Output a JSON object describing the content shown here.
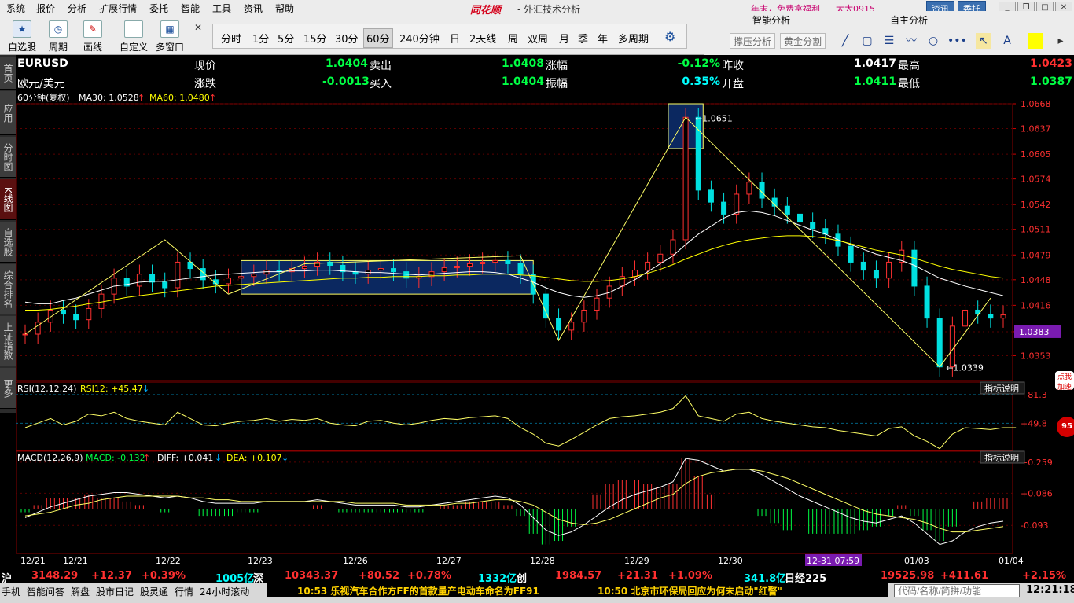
{
  "menubar": {
    "items": [
      "系统",
      "报价",
      "分析",
      "扩展行情",
      "委托",
      "智能",
      "工具",
      "资讯",
      "帮助"
    ],
    "title": "同花顺",
    "subtitle": "- 外汇技术分析",
    "promo": "年末，免费拿福利",
    "user": "太太0915",
    "btn_news": "资讯",
    "btn_trade": "委托"
  },
  "toolbar": {
    "buttons": [
      "自选股",
      "周期",
      "画线",
      "自定义",
      "多窗口"
    ],
    "periods": [
      "分时",
      "1分",
      "5分",
      "15分",
      "30分",
      "60分",
      "240分钟",
      "日",
      "2天线",
      "周",
      "双周",
      "月",
      "季",
      "年",
      "多周期"
    ],
    "active_period": "60分"
  },
  "side_panel": {
    "tab_smart": "智能分析",
    "tab_self": "自主分析",
    "btn_pressure": "撑压分析",
    "btn_gold": "黄金分割"
  },
  "leftnav": [
    "首页",
    "应用",
    "分时图",
    "K线图",
    "自选股",
    "综合排名",
    "上证指数",
    "更多"
  ],
  "quote": {
    "symbol": "EURUSD",
    "name": "欧元/美元",
    "l_price": "现价",
    "price": "1.0404",
    "l_change": "涨跌",
    "change": "-0.0013",
    "l_sell": "卖出",
    "sell": "1.0408",
    "l_buy": "买入",
    "buy": "1.0404",
    "l_pct": "涨幅",
    "pct": "-0.12%",
    "l_amp": "振幅",
    "amp": "0.35%",
    "l_prev": "昨收",
    "prev": "1.0417",
    "l_open": "开盘",
    "open": "1.0411",
    "l_high": "最高",
    "high": "1.0423",
    "l_low": "最低",
    "low": "1.0387"
  },
  "chart_data": {
    "type": "line",
    "title": "60分钟(复权)",
    "ma_legend": [
      "MA30: 1.0528",
      "MA60: 1.0480"
    ],
    "ylim": [
      1.0322,
      1.0668
    ],
    "y_ticks": [
      "1.0668",
      "1.0637",
      "1.0605",
      "1.0574",
      "1.0542",
      "1.0511",
      "1.0479",
      "1.0448",
      "1.0416",
      "1.0383",
      "1.0353"
    ],
    "current_tag": "1.0383",
    "annot_high": "1.0651",
    "annot_low": "1.0339",
    "x_labels": [
      "12/21",
      "12/21",
      "12/22",
      "12/23",
      "12/26",
      "12/27",
      "12/28",
      "12/29",
      "12/30",
      "12-31 07:59",
      "01/03",
      "01/04"
    ],
    "close_series": [
      1.038,
      1.0395,
      1.041,
      1.0405,
      1.0398,
      1.0412,
      1.043,
      1.045,
      1.044,
      1.0455,
      1.0445,
      1.0438,
      1.047,
      1.0462,
      1.0448,
      1.0443,
      1.045,
      1.0452,
      1.0455,
      1.046,
      1.0458,
      1.0462,
      1.0465,
      1.047,
      1.0466,
      1.0458,
      1.0455,
      1.046,
      1.0462,
      1.0458,
      1.045,
      1.0452,
      1.0458,
      1.0463,
      1.0465,
      1.0468,
      1.047,
      1.0472,
      1.0468,
      1.0455,
      1.043,
      1.04,
      1.0385,
      1.0395,
      1.041,
      1.0425,
      1.044,
      1.0452,
      1.046,
      1.047,
      1.048,
      1.0498,
      1.0651,
      1.056,
      1.0545,
      1.053,
      1.0555,
      1.057,
      1.055,
      1.054,
      1.053,
      1.052,
      1.0512,
      1.0505,
      1.049,
      1.047,
      1.046,
      1.045,
      1.047,
      1.0485,
      1.044,
      1.04,
      1.0339,
      1.039,
      1.041,
      1.0405,
      1.04,
      1.0404
    ],
    "ma30_series": [
      1.042,
      1.0418,
      1.0418,
      1.0422,
      1.0425,
      1.043,
      1.0435,
      1.044,
      1.0442,
      1.0445,
      1.0446,
      1.0446,
      1.0448,
      1.045,
      1.0452,
      1.0454,
      1.0455,
      1.0456,
      1.0457,
      1.0458,
      1.0458,
      1.0459,
      1.0459,
      1.046,
      1.046,
      1.0459,
      1.0458,
      1.0457,
      1.0457,
      1.0456,
      1.0455,
      1.0454,
      1.0455,
      1.0456,
      1.0457,
      1.0458,
      1.0458,
      1.0457,
      1.0455,
      1.045,
      1.0445,
      1.0438,
      1.0432,
      1.0428,
      1.0426,
      1.0428,
      1.0432,
      1.044,
      1.0448,
      1.0458,
      1.0468,
      1.0478,
      1.0492,
      1.0505,
      1.0515,
      1.0525,
      1.0532,
      1.0534,
      1.0532,
      1.0528,
      1.0522,
      1.0516,
      1.051,
      1.0505,
      1.0498,
      1.0492,
      1.0486,
      1.048,
      1.0476,
      1.0472,
      1.0466,
      1.0458,
      1.045,
      1.0445,
      1.044,
      1.0436,
      1.0432,
      1.0428
    ],
    "ma60_series": [
      1.041,
      1.041,
      1.0411,
      1.0413,
      1.0415,
      1.0418,
      1.042,
      1.0423,
      1.0426,
      1.0428,
      1.043,
      1.0432,
      1.0434,
      1.0436,
      1.0438,
      1.044,
      1.0441,
      1.0442,
      1.0443,
      1.0444,
      1.0445,
      1.0446,
      1.0447,
      1.0448,
      1.0449,
      1.045,
      1.045,
      1.0451,
      1.0451,
      1.0452,
      1.0452,
      1.0452,
      1.0453,
      1.0453,
      1.0454,
      1.0454,
      1.0455,
      1.0455,
      1.0455,
      1.0454,
      1.0453,
      1.0451,
      1.0449,
      1.0447,
      1.0446,
      1.0446,
      1.0447,
      1.0449,
      1.0452,
      1.0456,
      1.0461,
      1.0467,
      1.0474,
      1.048,
      1.0486,
      1.0491,
      1.0495,
      1.0498,
      1.05,
      1.0502,
      1.0503,
      1.0503,
      1.0502,
      1.05,
      1.0497,
      1.0493,
      1.0489,
      1.0485,
      1.0482,
      1.0479,
      1.0475,
      1.047,
      1.0465,
      1.0461,
      1.0458,
      1.0455,
      1.0452,
      1.045
    ],
    "rsi": {
      "legend": "RSI(12,12,24)",
      "value_label": "RSI12: +45.47",
      "ylim": [
        20,
        95
      ],
      "ticks": [
        "81.3",
        "49.8"
      ],
      "values": [
        45,
        50,
        55,
        48,
        52,
        60,
        58,
        62,
        55,
        52,
        50,
        48,
        62,
        55,
        48,
        47,
        50,
        52,
        53,
        55,
        52,
        54,
        53,
        55,
        50,
        48,
        47,
        52,
        53,
        50,
        48,
        50,
        53,
        55,
        54,
        56,
        57,
        58,
        55,
        45,
        38,
        28,
        25,
        32,
        40,
        48,
        55,
        57,
        58,
        60,
        62,
        66,
        80,
        58,
        55,
        52,
        60,
        62,
        55,
        52,
        50,
        48,
        46,
        45,
        42,
        40,
        38,
        36,
        44,
        46,
        36,
        30,
        22,
        38,
        45,
        44,
        43,
        45
      ]
    },
    "macd": {
      "legend": "MACD(12,26,9)",
      "macd_label": "MACD: -0.132",
      "diff_label": "DIFF: +0.041",
      "dea_label": "DEA: +0.107",
      "ylim": [
        -0.25,
        0.32
      ],
      "ticks": [
        "0.259",
        "0.086",
        "-0.093"
      ],
      "diff": [
        -0.05,
        -0.02,
        0.01,
        0.03,
        0.05,
        0.07,
        0.08,
        0.09,
        0.09,
        0.08,
        0.07,
        0.06,
        0.07,
        0.06,
        0.04,
        0.03,
        0.03,
        0.03,
        0.03,
        0.04,
        0.04,
        0.04,
        0.04,
        0.05,
        0.04,
        0.03,
        0.02,
        0.02,
        0.02,
        0.02,
        0.01,
        0.01,
        0.02,
        0.03,
        0.04,
        0.05,
        0.06,
        0.07,
        0.06,
        0.02,
        -0.05,
        -0.12,
        -0.15,
        -0.13,
        -0.09,
        -0.04,
        0.01,
        0.05,
        0.08,
        0.1,
        0.12,
        0.15,
        0.28,
        0.27,
        0.24,
        0.21,
        0.22,
        0.22,
        0.19,
        0.15,
        0.11,
        0.07,
        0.04,
        0.01,
        -0.02,
        -0.05,
        -0.07,
        -0.08,
        -0.06,
        -0.04,
        -0.08,
        -0.14,
        -0.2,
        -0.18,
        -0.13,
        -0.1,
        -0.08,
        -0.07
      ],
      "dea": [
        -0.04,
        -0.03,
        -0.02,
        0.0,
        0.02,
        0.03,
        0.05,
        0.06,
        0.07,
        0.07,
        0.07,
        0.07,
        0.07,
        0.06,
        0.06,
        0.05,
        0.05,
        0.04,
        0.04,
        0.04,
        0.04,
        0.04,
        0.04,
        0.04,
        0.04,
        0.04,
        0.03,
        0.03,
        0.03,
        0.03,
        0.02,
        0.02,
        0.02,
        0.02,
        0.03,
        0.03,
        0.04,
        0.05,
        0.05,
        0.04,
        0.02,
        -0.02,
        -0.06,
        -0.08,
        -0.09,
        -0.08,
        -0.06,
        -0.03,
        0.0,
        0.03,
        0.06,
        0.08,
        0.14,
        0.18,
        0.2,
        0.21,
        0.22,
        0.22,
        0.21,
        0.19,
        0.17,
        0.14,
        0.11,
        0.08,
        0.05,
        0.02,
        -0.01,
        -0.03,
        -0.04,
        -0.05,
        -0.06,
        -0.08,
        -0.11,
        -0.13,
        -0.13,
        -0.12,
        -0.11,
        -0.1
      ]
    }
  },
  "indicator_btn": "指标说明",
  "index_bar": {
    "sh_label": "沪",
    "sh_val": "3148.29",
    "sh_chg": "+12.37",
    "sh_pct": "+0.39%",
    "sh_amt": "1005亿",
    "sz_label": "深",
    "sz_val": "10343.37",
    "sz_chg": "+80.52",
    "sz_pct": "+0.78%",
    "sz_amt": "1332亿",
    "cy_label": "创",
    "cy_val": "1984.57",
    "cy_chg": "+21.31",
    "cy_pct": "+1.09%",
    "cy_amt": "341.8亿",
    "dj_label": "日经225",
    "dj_val": "19525.98",
    "dj_chg": "+411.61",
    "dj_pct": "+2.15%"
  },
  "statusbar": {
    "items": [
      "手机",
      "智能问答",
      "解盘",
      "股市日记",
      "股灵通",
      "行情",
      "24小时滚动"
    ],
    "news1": "10:53 乐视汽车合作方FF的首款量产电动车命名为FF91",
    "news2": "10:50 北京市环保局回应为何未启动\"红警\"",
    "search": "代码/名称/简拼/功能",
    "clock": "12:21:18"
  },
  "badge": "点我加速",
  "ball": "95"
}
